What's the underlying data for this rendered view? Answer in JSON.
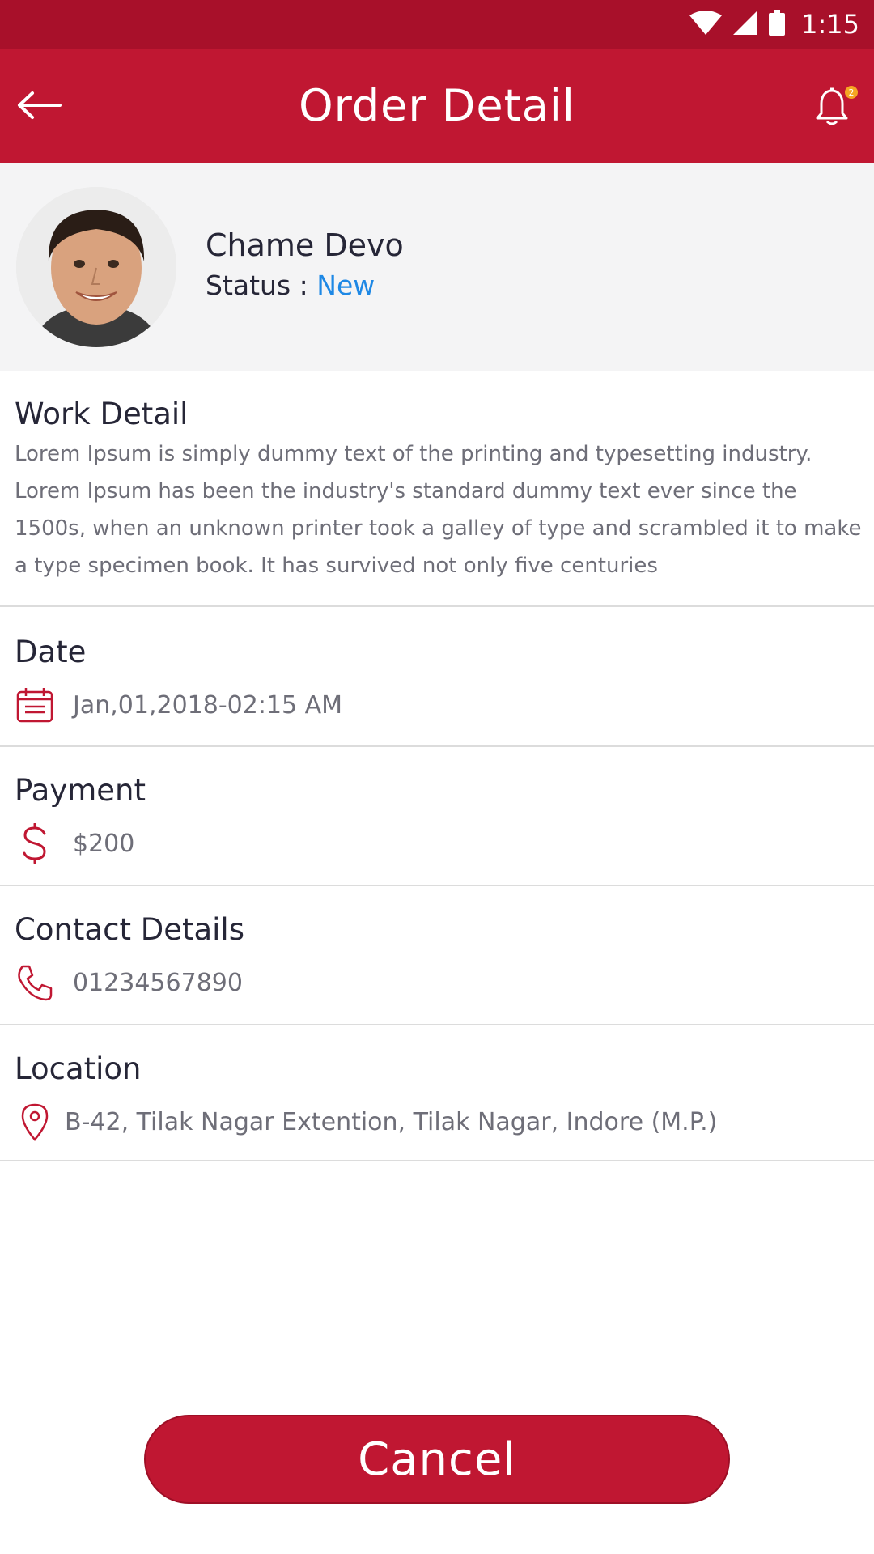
{
  "status_bar": {
    "time": "1:15"
  },
  "app_bar": {
    "title": "Order Detail",
    "notification_count": "2"
  },
  "profile": {
    "name": "Chame Devo",
    "status_label": "Status : ",
    "status_value": "New"
  },
  "work_detail": {
    "heading": "Work Detail",
    "text": "Lorem Ipsum is simply dummy text of the printing and typesetting industry. Lorem Ipsum has been the industry's standard dummy text ever since the 1500s, when an unknown printer took a galley of type and scrambled it to make a type specimen book. It has survived not only five centuries"
  },
  "date": {
    "heading": "Date",
    "value": "Jan,01,2018-02:15 AM"
  },
  "payment": {
    "heading": "Payment",
    "value": "$200"
  },
  "contact": {
    "heading": "Contact Details",
    "value": "01234567890"
  },
  "location": {
    "heading": "Location",
    "value": "B-42, Tilak Nagar Extention, Tilak Nagar, Indore (M.P.)"
  },
  "actions": {
    "cancel_label": "Cancel"
  },
  "colors": {
    "primary": "#C01732",
    "status_bar": "#A8102A",
    "status_new": "#1E88E5",
    "badge": "#F5A623"
  }
}
